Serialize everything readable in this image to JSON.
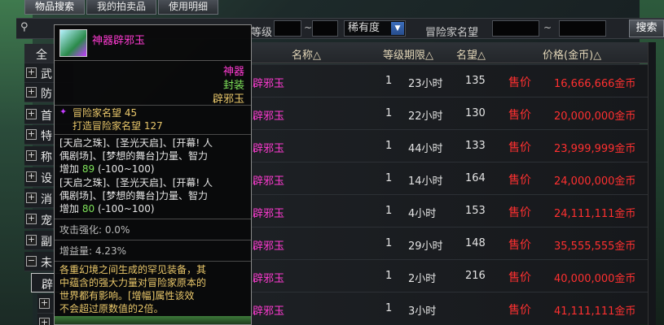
{
  "tabs": [
    "物品搜索",
    "我的拍卖品",
    "使用明细"
  ],
  "filter": {
    "level_label": "等级",
    "tilde": "~",
    "rarity": "稀有度",
    "rep_label": "冒险家名望",
    "search_button": "搜索"
  },
  "sidebar": {
    "header": "全",
    "items": [
      "武",
      "防",
      "首",
      "特",
      "称",
      "设",
      "消",
      "宠",
      "副",
      "未",
      "辟"
    ]
  },
  "table": {
    "headers": {
      "name": "名称△",
      "level": "等级期限△",
      "rep": "名望△",
      "price": "价格(金币)△"
    },
    "rows": [
      {
        "name": "辟邪玉",
        "level": "1",
        "time": "23小时",
        "rep": "135",
        "sell": "售价",
        "price": "16,666,666金币"
      },
      {
        "name": "辟邪玉",
        "level": "1",
        "time": "22小时",
        "rep": "130",
        "sell": "售价",
        "price": "20,000,000金币"
      },
      {
        "name": "辟邪玉",
        "level": "1",
        "time": "44小时",
        "rep": "133",
        "sell": "售价",
        "price": "23,999,999金币"
      },
      {
        "name": "辟邪玉",
        "level": "1",
        "time": "14小时",
        "rep": "164",
        "sell": "售价",
        "price": "24,000,000金币"
      },
      {
        "name": "辟邪玉",
        "level": "1",
        "time": "4小时",
        "rep": "153",
        "sell": "售价",
        "price": "24,111,111金币"
      },
      {
        "name": "辟邪玉",
        "level": "1",
        "time": "29小时",
        "rep": "148",
        "sell": "售价",
        "price": "35,555,555金币"
      },
      {
        "name": "辟邪玉",
        "level": "1",
        "time": "2小时",
        "rep": "216",
        "sell": "售价",
        "price": "40,000,000金币"
      },
      {
        "name": "辟邪玉",
        "level": "1",
        "time": "3小时",
        "rep": "",
        "sell": "售价",
        "price": "41,111,111金币"
      }
    ]
  },
  "tooltip": {
    "title": "神器辟邪玉",
    "rarity": "神器",
    "sealed": "封装",
    "type": "辟邪玉",
    "rep_line": "冒险家名望 45",
    "forge_rep": "打造冒险家名望 127",
    "effect1_a": "[天启之珠]、[圣光天启]、[开幕! 人",
    "effect1_b": "偶剧场]、[梦想的舞台]力量、智力",
    "effect1_c_label": "增加",
    "effect1_c_val": "89",
    "effect1_c_range": "(-100~100)",
    "effect2_a": "[天启之珠]、[圣光天启]、[开幕! 人",
    "effect2_b": "偶剧场]、[梦想的舞台]力量、智力",
    "effect2_c_label": "增加",
    "effect2_c_val": "80",
    "effect2_c_range": "(-100~100)",
    "atk": "攻击强化: 0.0%",
    "gain": "增益量: 4.23%",
    "desc1": "各重幻境之间生成的罕见装备，其",
    "desc2": "中蕴含的强大力量对冒险家原本的",
    "desc3": "世界都有影响。[增幅]属性该效",
    "desc4": "不会超过原数值的2倍。"
  },
  "colors": {
    "epic": "#ff3bd2",
    "price": "#ff3030",
    "green": "#7fe35a",
    "gold": "#e9c76a"
  }
}
